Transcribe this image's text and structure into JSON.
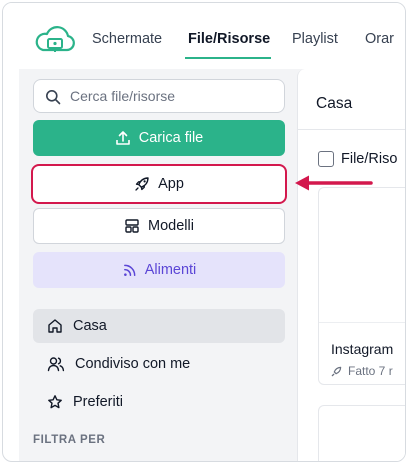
{
  "nav": {
    "tabs": [
      {
        "label": "Schermate"
      },
      {
        "label": "File/Risorse"
      },
      {
        "label": "Playlist"
      },
      {
        "label": "Orar"
      }
    ]
  },
  "sidebar": {
    "search_placeholder": "Cerca file/risorse",
    "upload_label": "Carica file",
    "app_label": "App",
    "models_label": "Modelli",
    "feeds_label": "Alimenti",
    "items": [
      {
        "label": "Casa"
      },
      {
        "label": "Condiviso con me"
      },
      {
        "label": "Preferiti"
      }
    ],
    "filter_label": "FILTRA PER"
  },
  "main": {
    "title": "Casa",
    "column_header": "File/Riso",
    "card": {
      "title": "Instagram",
      "meta": "Fatto 7 r"
    }
  },
  "colors": {
    "accent": "#2bb38a",
    "highlight": "#d3184d",
    "feeds_bg": "#e5e3fb",
    "feeds_text": "#5b46d6"
  },
  "icons": [
    "cloud-monitor-logo",
    "search-icon",
    "upload-icon",
    "rocket-icon",
    "layout-icon",
    "rss-icon",
    "home-icon",
    "users-icon",
    "star-icon",
    "arrow-left-icon"
  ]
}
